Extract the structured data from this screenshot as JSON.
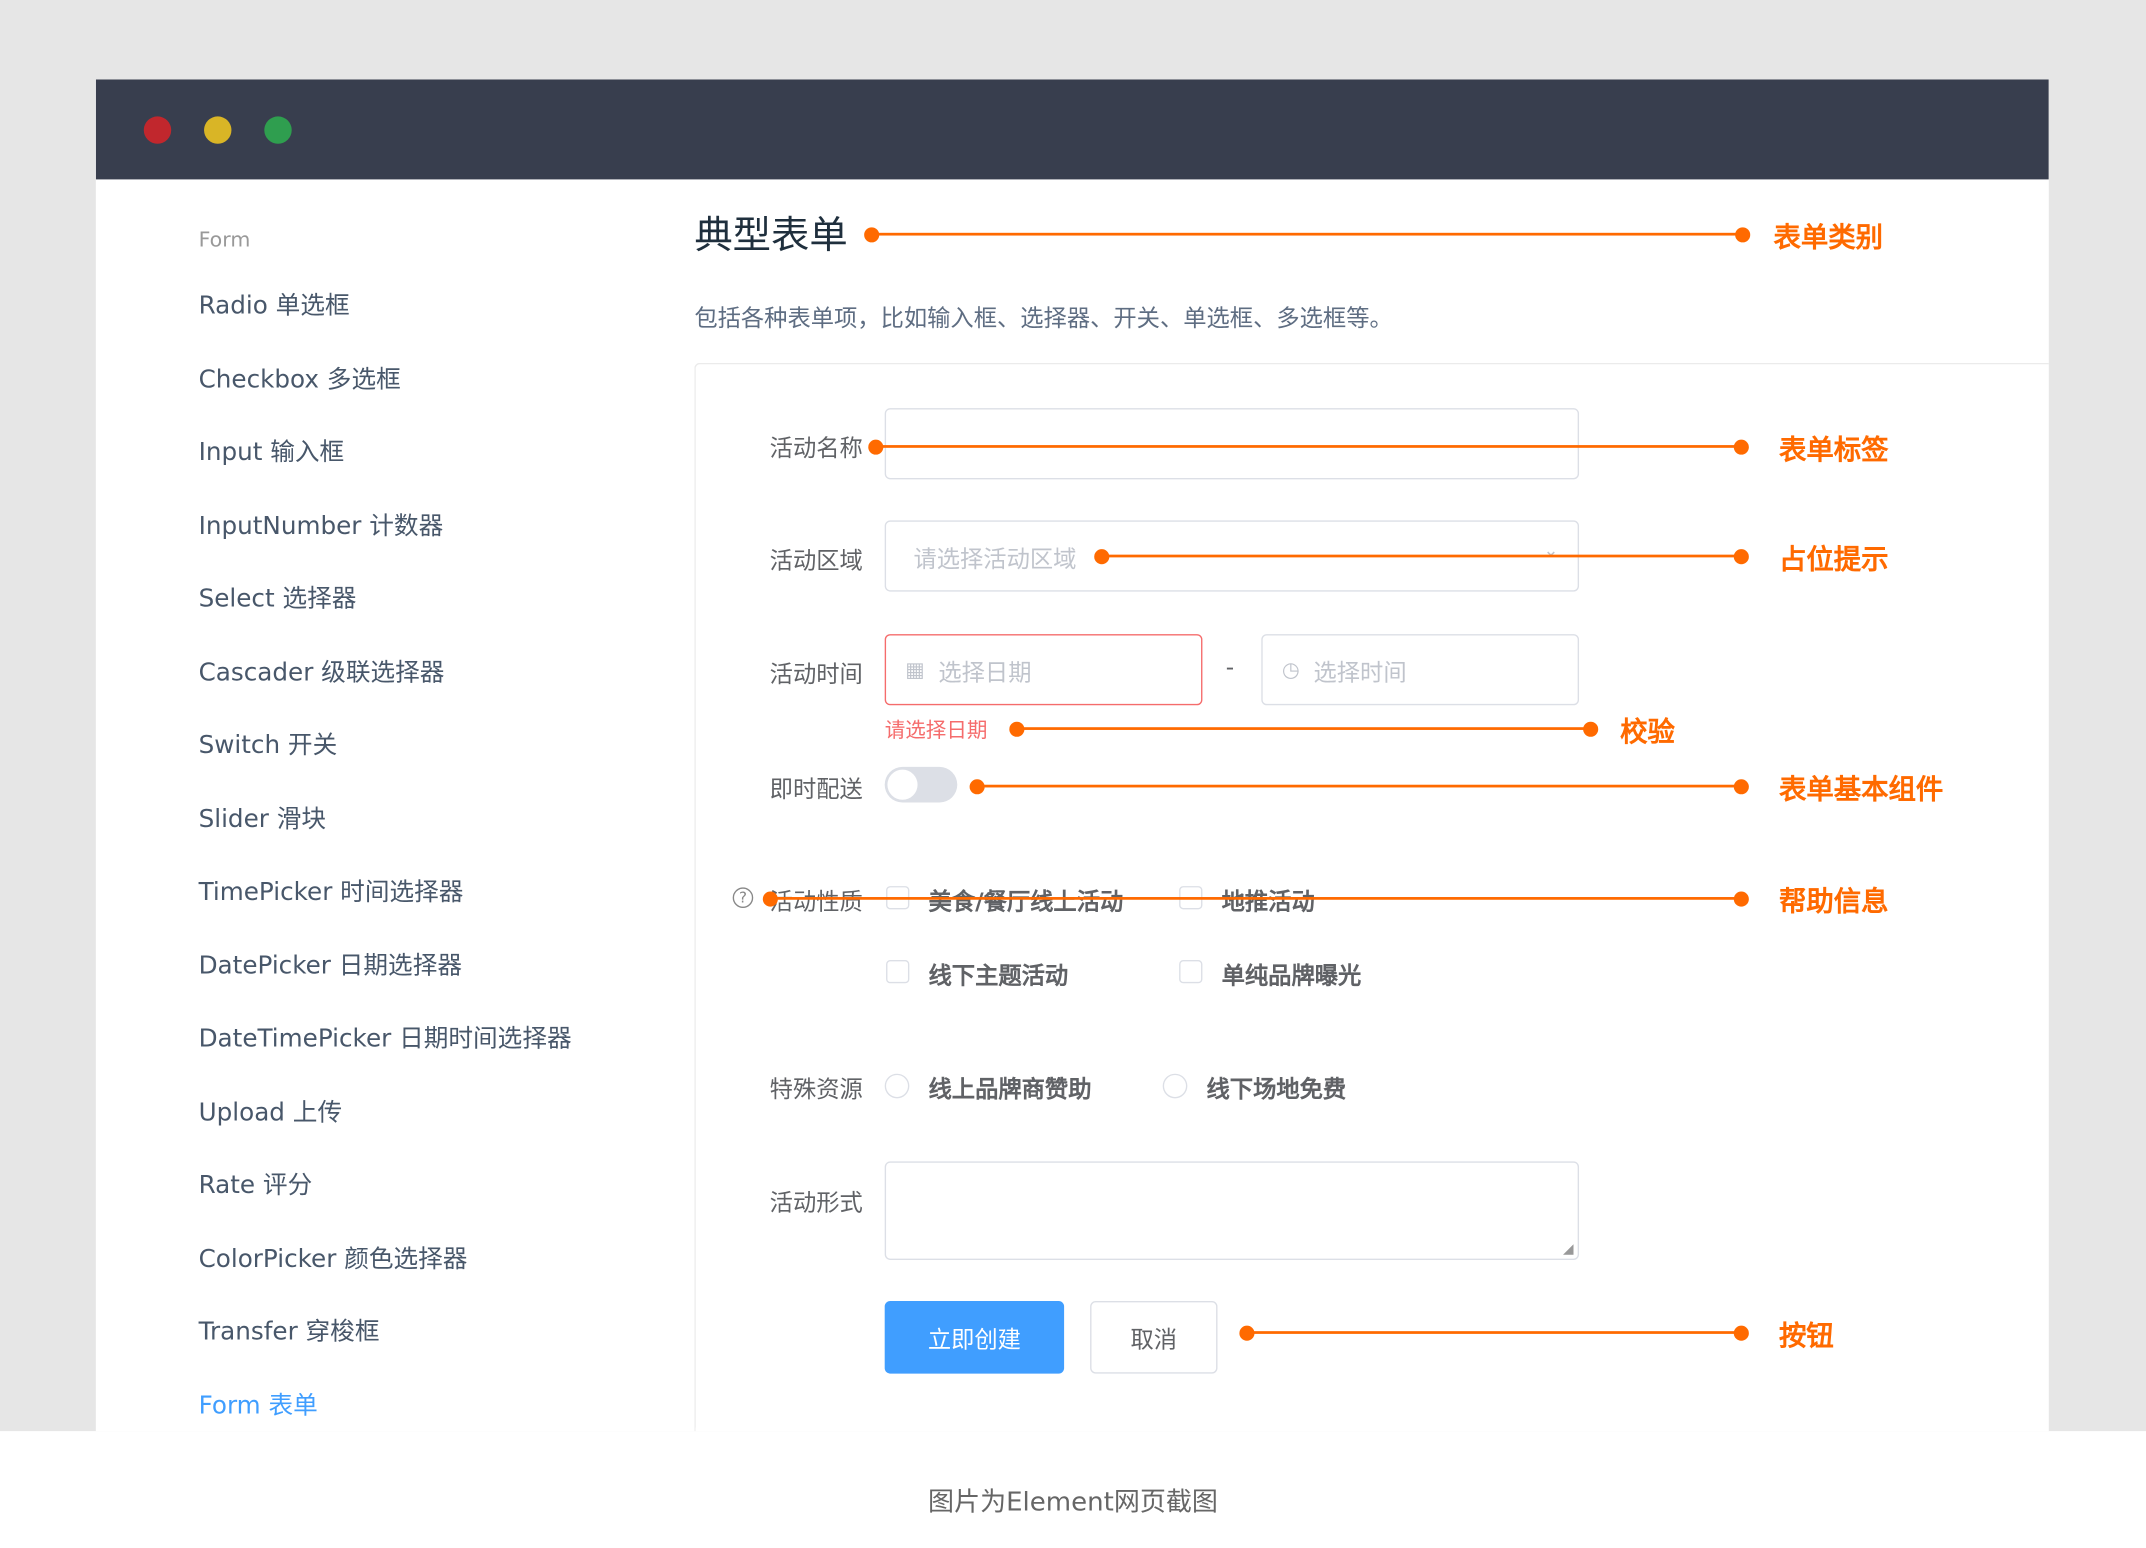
{
  "window": {
    "controls": [
      {
        "name": "close",
        "color": "#c1272d"
      },
      {
        "name": "minimize",
        "color": "#d9b526"
      },
      {
        "name": "maximize",
        "color": "#2f9e4f"
      }
    ]
  },
  "sidebar": {
    "caption": "Form",
    "items": [
      {
        "label": "Radio 单选框"
      },
      {
        "label": "Checkbox 多选框"
      },
      {
        "label": "Input 输入框"
      },
      {
        "label": "InputNumber 计数器"
      },
      {
        "label": "Select 选择器"
      },
      {
        "label": "Cascader 级联选择器"
      },
      {
        "label": "Switch 开关"
      },
      {
        "label": "Slider 滑块"
      },
      {
        "label": "TimePicker 时间选择器"
      },
      {
        "label": "DatePicker 日期选择器"
      },
      {
        "label": "DateTimePicker 日期时间选择器"
      },
      {
        "label": "Upload 上传"
      },
      {
        "label": "Rate 评分"
      },
      {
        "label": "ColorPicker 颜色选择器"
      },
      {
        "label": "Transfer 穿梭框"
      },
      {
        "label": "Form 表单",
        "active": true
      }
    ]
  },
  "main": {
    "title": "典型表单",
    "description": "包括各种表单项，比如输入框、选择器、开关、单选框、多选框等。",
    "form": {
      "name": {
        "label": "活动名称",
        "value": ""
      },
      "region": {
        "label": "活动区域",
        "placeholder": "请选择活动区域"
      },
      "time": {
        "label": "活动时间",
        "date_placeholder": "选择日期",
        "separator": "-",
        "time_placeholder": "选择时间",
        "error": "请选择日期"
      },
      "delivery": {
        "label": "即时配送",
        "on": false
      },
      "type": {
        "label": "活动性质",
        "options": [
          "美食/餐厅线上活动",
          "地推活动",
          "线下主题活动",
          "单纯品牌曝光"
        ]
      },
      "resource": {
        "label": "特殊资源",
        "options": [
          "线上品牌商赞助",
          "线下场地免费"
        ]
      },
      "desc": {
        "label": "活动形式",
        "value": ""
      },
      "submit": "立即创建",
      "cancel": "取消"
    }
  },
  "annotations": {
    "color": "#ff6a00",
    "items": [
      "表单类别",
      "表单标签",
      "占位提示",
      "校验",
      "表单基本组件",
      "帮助信息",
      "按钮"
    ]
  },
  "caption": "图片为Element网页截图",
  "colors": {
    "titlebar": "#383e4e",
    "primary": "#409eff",
    "error": "#f56c6c"
  }
}
